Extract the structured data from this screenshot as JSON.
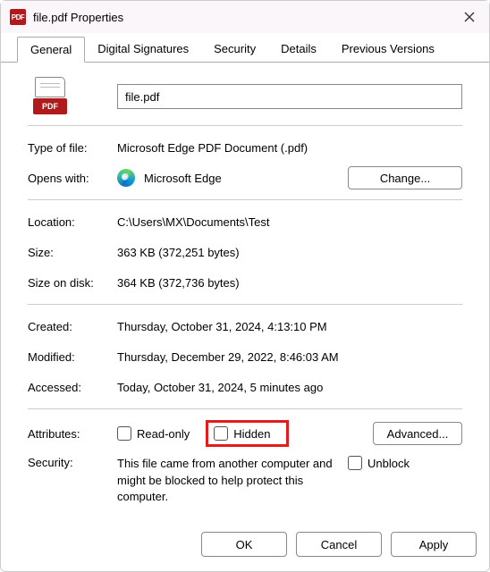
{
  "title": "file.pdf Properties",
  "tabs": {
    "general": "General",
    "signatures": "Digital Signatures",
    "security": "Security",
    "details": "Details",
    "previous": "Previous Versions"
  },
  "filename": "file.pdf",
  "labels": {
    "type": "Type of file:",
    "opens": "Opens with:",
    "change": "Change...",
    "location": "Location:",
    "size": "Size:",
    "sizeondisk": "Size on disk:",
    "created": "Created:",
    "modified": "Modified:",
    "accessed": "Accessed:",
    "attributes": "Attributes:",
    "readonly": "Read-only",
    "hidden": "Hidden",
    "advanced": "Advanced...",
    "securitylbl": "Security:",
    "security_text": "This file came from another computer and might be blocked to help protect this computer.",
    "unblock": "Unblock"
  },
  "values": {
    "type": "Microsoft Edge PDF Document (.pdf)",
    "opens": "Microsoft Edge",
    "location": "C:\\Users\\MX\\Documents\\Test",
    "size": "363 KB (372,251 bytes)",
    "sizeondisk": "364 KB (372,736 bytes)",
    "created": "Thursday, October 31, 2024, 4:13:10 PM",
    "modified": "Thursday, December 29, 2022, 8:46:03 AM",
    "accessed": "Today, October 31, 2024, 5 minutes ago"
  },
  "footer": {
    "ok": "OK",
    "cancel": "Cancel",
    "apply": "Apply"
  },
  "icon": {
    "pdf_label": "PDF"
  }
}
